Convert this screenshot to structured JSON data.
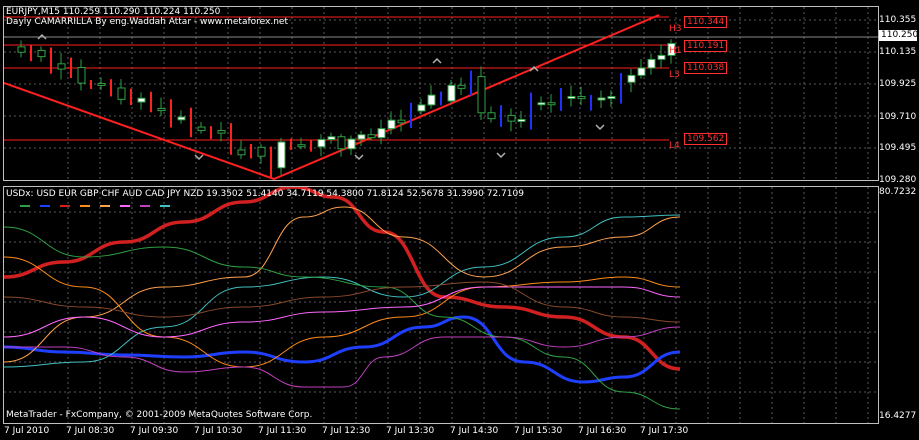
{
  "header": {
    "symbol_info": "EURJPY,M15  110.259 110.290 110.224 110.250",
    "indicator_title": "Dayly CAMARRILLA By eng.Waddah Attar - www.metaforex.net"
  },
  "price_axis": {
    "labels": [
      "110.355",
      "110.135",
      "109.925",
      "109.710",
      "109.495",
      "109.280"
    ],
    "bid": "110.250"
  },
  "levels": [
    {
      "value": "110.344",
      "tag": "H3"
    },
    {
      "value": "110.191",
      "tag": "H1"
    },
    {
      "value": "110.038",
      "tag": "L3"
    },
    {
      "value": "109.562",
      "tag": "L4"
    }
  ],
  "indicator": {
    "label": "USDx: USD EUR GBP CHF AUD CAD JPY NZD",
    "values": "19.3502 51.4140 34.7119 54.3800 71.8124 52.5678 31.3990 72.7109",
    "max_label": "80.7232",
    "min_label": "16.4277",
    "legend_colors": [
      "#2ea043",
      "#1f3fff",
      "#d22020",
      "#ff8c1a",
      "#ffa24d",
      "#ff66ff",
      "#c040c0",
      "#40c0c0"
    ]
  },
  "footer": {
    "copyright": "MetaTrader - FxCompany, © 2001-2009 MetaQuotes Software Corp."
  },
  "time_axis": {
    "labels": [
      "7 Jul 2010",
      "7 Jul 08:30",
      "7 Jul 09:30",
      "7 Jul 10:30",
      "7 Jul 11:30",
      "7 Jul 12:30",
      "7 Jul 13:30",
      "7 Jul 14:30",
      "7 Jul 15:30",
      "7 Jul 16:30",
      "7 Jul 17:30"
    ]
  },
  "colors": {
    "background": "#000000",
    "bull_candle": "#ffffff",
    "bear_candle": "#000000",
    "level_line": "#ff2020",
    "trendline": "#ff2020",
    "grid": "#5a5a5a"
  }
}
